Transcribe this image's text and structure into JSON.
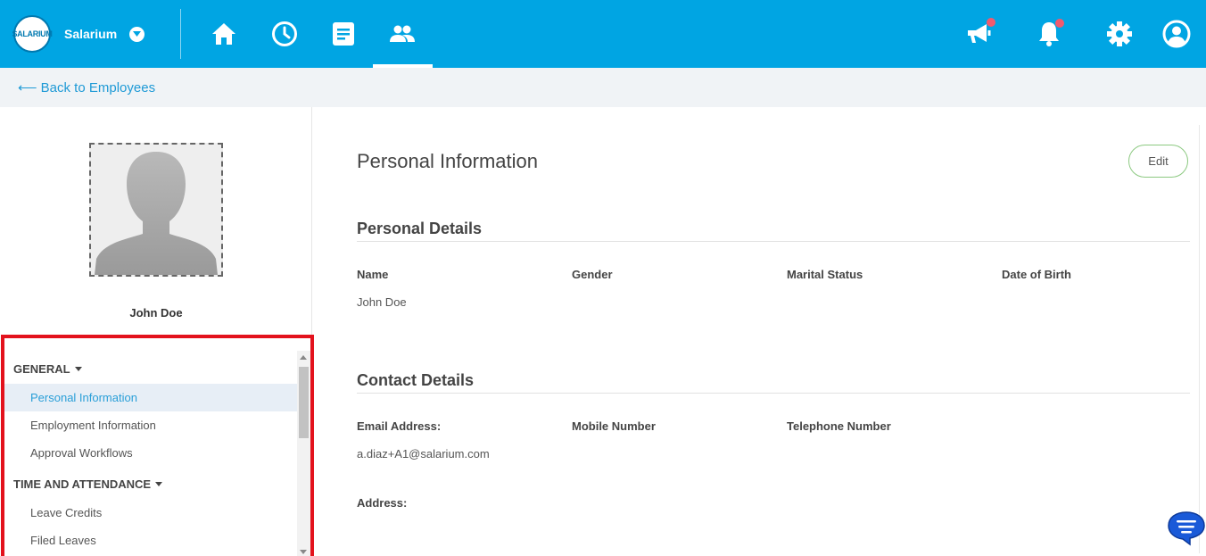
{
  "header": {
    "brand_name": "Salarium",
    "logo_text": "SALARIUM",
    "nav": [
      "home-icon",
      "clock-icon",
      "document-icon",
      "people-icon"
    ],
    "active_nav": "people-icon",
    "right_icons": [
      "megaphone-icon",
      "bell-icon",
      "gear-icon",
      "account-icon"
    ]
  },
  "subbar": {
    "back_link": "⟵ Back to Employees"
  },
  "sidebar": {
    "employee_name": "John Doe",
    "sections": [
      {
        "title": "GENERAL",
        "items": [
          "Personal Information",
          "Employment Information",
          "Approval Workflows"
        ]
      },
      {
        "title": "TIME AND ATTENDANCE",
        "items": [
          "Leave Credits",
          "Filed Leaves"
        ]
      }
    ],
    "active_item": "Personal Information"
  },
  "main": {
    "page_title": "Personal Information",
    "edit_label": "Edit",
    "personal_details": {
      "title": "Personal Details",
      "labels": [
        "Name",
        "Gender",
        "Marital Status",
        "Date of Birth"
      ],
      "values": [
        "John Doe",
        "",
        "",
        ""
      ]
    },
    "contact_details": {
      "title": "Contact Details",
      "labels": [
        "Email Address:",
        "Mobile Number",
        "Telephone Number"
      ],
      "values": [
        "a.diaz+A1@salarium.com",
        "",
        ""
      ],
      "address_label": "Address:"
    }
  },
  "colors": {
    "topbar": "#00a5e3",
    "link": "#1f9ad6",
    "highlight_border": "#e3121d",
    "edit_border": "#8cc981",
    "notification_dot": "#f05a6e"
  }
}
